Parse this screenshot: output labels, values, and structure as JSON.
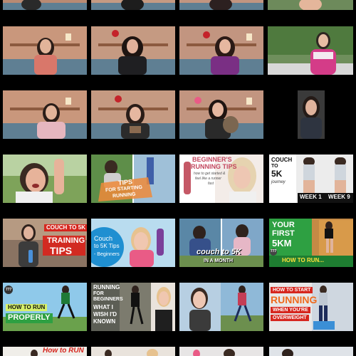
{
  "grid": {
    "rows": [
      {
        "row": 0,
        "tiles": [
          {
            "id": "r0c0",
            "kind": "video-room"
          },
          {
            "id": "r0c1",
            "kind": "video-room"
          },
          {
            "id": "r0c2",
            "kind": "video-room"
          },
          {
            "id": "r0c3",
            "kind": "video-room"
          }
        ]
      },
      {
        "row": 1,
        "tiles": [
          {
            "id": "r1c0",
            "kind": "video-room"
          },
          {
            "id": "r1c1",
            "kind": "video-room"
          },
          {
            "id": "r1c2",
            "kind": "video-room"
          },
          {
            "id": "r1c3",
            "kind": "video-outdoor"
          }
        ]
      },
      {
        "row": 2,
        "tiles": [
          {
            "id": "r2c0",
            "kind": "video-room"
          },
          {
            "id": "r2c1",
            "kind": "video-room"
          },
          {
            "id": "r2c2",
            "kind": "video-room"
          },
          {
            "id": "r2c3",
            "kind": "video-car"
          }
        ]
      },
      {
        "row": 3,
        "tiles": [
          {
            "id": "r3c0",
            "kind": "video-outdoor"
          },
          {
            "id": "r3c1",
            "kind": "thumbnail",
            "texts": [
              "TIPS",
              "FOR STARTING",
              "RUNNING"
            ]
          },
          {
            "id": "r3c2",
            "kind": "thumbnail",
            "texts": [
              "BEGINNER'S",
              "RUNNING TIPS",
              "how to get started &",
              "feel like a runner",
              "fast"
            ]
          },
          {
            "id": "r3c3",
            "kind": "thumbnail",
            "texts": [
              "COUCH",
              "TO",
              "5K",
              "journey",
              "WEEK 1",
              "WEEK 9"
            ]
          }
        ]
      },
      {
        "row": 4,
        "tiles": [
          {
            "id": "r4c0",
            "kind": "thumbnail",
            "texts": [
              "COUCH TO 5K",
              "TRAINING",
              "TIPS"
            ]
          },
          {
            "id": "r4c1",
            "kind": "thumbnail",
            "texts": [
              "Couch",
              "to 5K Tips",
              "- Beginners"
            ]
          },
          {
            "id": "r4c2",
            "kind": "thumbnail",
            "texts": [
              "couch to 5K",
              "IN A MONTH"
            ]
          },
          {
            "id": "r4c3",
            "kind": "thumbnail",
            "texts": [
              "YOUR",
              "FIRST",
              "5KM",
              "HOW TO RUN..."
            ]
          }
        ]
      },
      {
        "row": 5,
        "tiles": [
          {
            "id": "r5c0",
            "kind": "thumbnail",
            "texts": [
              "HOW TO RUN",
              "PROPERLY"
            ]
          },
          {
            "id": "r5c1",
            "kind": "thumbnail",
            "texts": [
              "RUNNING",
              "FOR",
              "BEGINNERS",
              "WHAT I",
              "WISH I'D",
              "KNOWN"
            ]
          },
          {
            "id": "r5c2",
            "kind": "thumbnail",
            "texts": []
          },
          {
            "id": "r5c3",
            "kind": "thumbnail",
            "texts": [
              "HOW TO START",
              "RUNNING",
              "WHEN YOU'RE",
              "OVERWEIGHT"
            ]
          }
        ]
      },
      {
        "row": 6,
        "tiles": [
          {
            "id": "r6c0",
            "kind": "thumbnail",
            "texts": [
              "How to RUN"
            ]
          },
          {
            "id": "r6c1",
            "kind": "thumbnail",
            "texts": []
          },
          {
            "id": "r6c2",
            "kind": "thumbnail",
            "texts": []
          },
          {
            "id": "r6c3",
            "kind": "thumbnail",
            "texts": []
          }
        ]
      }
    ]
  },
  "colors": {
    "background": "#000000",
    "room_wall": "#c9977c",
    "sofa": "#5f7f93",
    "green_accent": "#2ea042",
    "orange_accent": "#ef6a1e",
    "red_accent": "#d6261e",
    "blue_accent": "#1f5fa8"
  },
  "badges": {
    "logo_777": "777"
  },
  "texts": {
    "r3c1_l1": "TIPS",
    "r3c1_l2": "FOR STARTING",
    "r3c1_l3": "RUNNING",
    "r3c2_l1": "BEGINNER'S",
    "r3c2_l2": "RUNNING TIPS",
    "r3c2_l3": "how to get started &",
    "r3c2_l4": "feel like a runner",
    "r3c2_l5": "fast",
    "r3c3_l1": "COUCH",
    "r3c3_l2": "TO",
    "r3c3_l3": "5K",
    "r3c3_l4": "journey",
    "r3c3_l5": "WEEK 1",
    "r3c3_l6": "WEEK 9",
    "r4c0_l1": "COUCH TO 5K",
    "r4c0_l2": "TRAINING",
    "r4c0_l3": "TIPS",
    "r4c1_l1": "Couch",
    "r4c1_l2": "to 5K Tips",
    "r4c1_l3": "- Beginners",
    "r4c2_l1": "couch to 5K",
    "r4c2_l2": "IN A MONTH",
    "r4c3_l1": "YOUR",
    "r4c3_l2": "FIRST",
    "r4c3_l3": "5KM",
    "r4c3_l4": "HOW TO RUN...",
    "r5c0_l1": "HOW TO RUN",
    "r5c0_l2": "PROPERLY",
    "r5c1_l1": "RUNNING",
    "r5c1_l2": "FOR",
    "r5c1_l3": "BEGINNERS",
    "r5c1_l4": "WHAT I",
    "r5c1_l5": "WISH I'D",
    "r5c1_l6": "KNOWN",
    "r5c3_l1": "HOW TO START",
    "r5c3_l2": "RUNNING",
    "r5c3_l3": "WHEN YOU'RE",
    "r5c3_l4": "OVERWEIGHT",
    "r6c0_l1": "How to RUN"
  }
}
